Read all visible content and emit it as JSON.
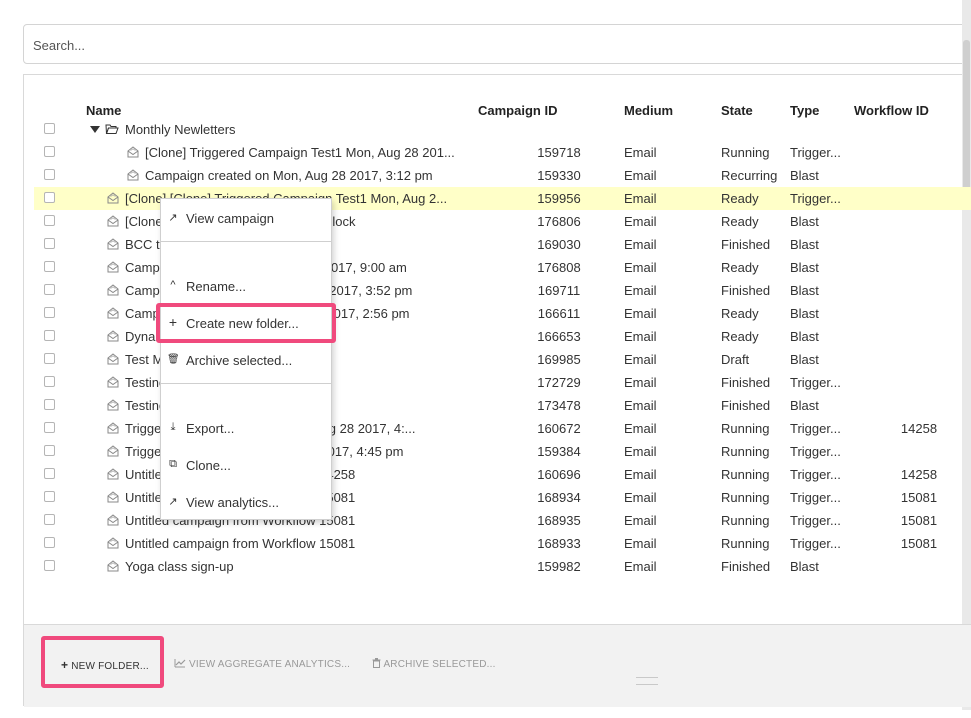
{
  "search": {
    "placeholder": "Search..."
  },
  "columns": {
    "name": "Name",
    "campaign_id": "Campaign ID",
    "medium": "Medium",
    "state": "State",
    "type": "Type",
    "workflow_id": "Workflow ID"
  },
  "rows": [
    {
      "name": "Monthly Newletters",
      "campaign_id": "",
      "medium": "",
      "state": "",
      "type": "",
      "workflow_id": "",
      "icon": "folder-open-icon"
    },
    {
      "name": "[Clone] Triggered Campaign Test1 Mon, Aug 28 201...",
      "campaign_id": "159718",
      "medium": "Email",
      "state": "Running",
      "type": "Trigger...",
      "workflow_id": "",
      "icon": "envelope-icon"
    },
    {
      "name": "Campaign created on Mon, Aug 28 2017, 3:12 pm",
      "campaign_id": "159330",
      "medium": "Email",
      "state": "Recurring",
      "type": "Blast",
      "workflow_id": "",
      "icon": "envelope-icon"
    },
    {
      "name": "[Clone] [Clone] Triggered Campaign Test1 Mon, Aug 2...",
      "campaign_id": "159956",
      "medium": "Email",
      "state": "Ready",
      "type": "Trigger...",
      "workflow_id": "",
      "icon": "envelope-icon"
    },
    {
      "name": "[Clone] Campaign with conditional block",
      "campaign_id": "176806",
      "medium": "Email",
      "state": "Ready",
      "type": "Blast",
      "workflow_id": "",
      "icon": "envelope-icon"
    },
    {
      "name": "BCC test",
      "campaign_id": "169030",
      "medium": "Email",
      "state": "Finished",
      "type": "Blast",
      "workflow_id": "",
      "icon": "envelope-icon"
    },
    {
      "name": "Campaign created on Tue, Oct 22 2017, 9:00 am",
      "campaign_id": "176808",
      "medium": "Email",
      "state": "Ready",
      "type": "Blast",
      "workflow_id": "",
      "icon": "envelope-icon"
    },
    {
      "name": "Campaign created on Mon, Sep 11 2017, 3:52 pm",
      "campaign_id": "169711",
      "medium": "Email",
      "state": "Finished",
      "type": "Blast",
      "workflow_id": "",
      "icon": "envelope-icon"
    },
    {
      "name": "Campaign created on Thu, Aug 31 2017, 2:56 pm",
      "campaign_id": "166611",
      "medium": "Email",
      "state": "Ready",
      "type": "Blast",
      "workflow_id": "",
      "icon": "envelope-icon"
    },
    {
      "name": "Dynamic content",
      "campaign_id": "166653",
      "medium": "Email",
      "state": "Ready",
      "type": "Blast",
      "workflow_id": "",
      "icon": "envelope-icon"
    },
    {
      "name": "Test Merge tags",
      "campaign_id": "169985",
      "medium": "Email",
      "state": "Draft",
      "type": "Blast",
      "workflow_id": "",
      "icon": "envelope-icon"
    },
    {
      "name": "Testing triggered",
      "campaign_id": "172729",
      "medium": "Email",
      "state": "Finished",
      "type": "Trigger...",
      "workflow_id": "",
      "icon": "envelope-icon"
    },
    {
      "name": "Testing blast",
      "campaign_id": "173478",
      "medium": "Email",
      "state": "Finished",
      "type": "Blast",
      "workflow_id": "",
      "icon": "envelope-icon"
    },
    {
      "name": "Triggered Campaign Test1 Mon, Aug 28 2017, 4:...",
      "campaign_id": "160672",
      "medium": "Email",
      "state": "Running",
      "type": "Trigger...",
      "workflow_id": "14258",
      "icon": "envelope-icon"
    },
    {
      "name": "Triggered campaign Mon, Aug 28 2017, 4:45 pm",
      "campaign_id": "159384",
      "medium": "Email",
      "state": "Running",
      "type": "Trigger...",
      "workflow_id": "",
      "icon": "envelope-icon"
    },
    {
      "name": "Untitled campaign from Workflow 14258",
      "campaign_id": "160696",
      "medium": "Email",
      "state": "Running",
      "type": "Trigger...",
      "workflow_id": "14258",
      "icon": "envelope-icon"
    },
    {
      "name": "Untitled campaign from Workflow 15081",
      "campaign_id": "168934",
      "medium": "Email",
      "state": "Running",
      "type": "Trigger...",
      "workflow_id": "15081",
      "icon": "envelope-icon"
    },
    {
      "name": "Untitled campaign from Workflow 15081",
      "campaign_id": "168935",
      "medium": "Email",
      "state": "Running",
      "type": "Trigger...",
      "workflow_id": "15081",
      "icon": "envelope-icon"
    },
    {
      "name": "Untitled campaign from Workflow 15081",
      "campaign_id": "168933",
      "medium": "Email",
      "state": "Running",
      "type": "Trigger...",
      "workflow_id": "15081",
      "icon": "envelope-icon"
    },
    {
      "name": "Yoga class sign-up",
      "campaign_id": "159982",
      "medium": "Email",
      "state": "Finished",
      "type": "Blast",
      "workflow_id": "",
      "icon": "envelope-icon"
    }
  ],
  "context_menu": {
    "items": [
      {
        "label": "View campaign",
        "glyph": "↗",
        "icon": "external-link-icon"
      },
      {
        "label": "Rename...",
        "glyph": "^",
        "icon": "caret-up-icon"
      },
      {
        "label": "Create new folder...",
        "glyph": "+",
        "icon": "plus-icon"
      },
      {
        "label": "Archive selected...",
        "glyph": "🗑",
        "icon": "trash-icon"
      },
      {
        "label": "Export...",
        "glyph": "⤓",
        "icon": "download-icon"
      },
      {
        "label": "Clone...",
        "glyph": "⧉",
        "icon": "clone-icon"
      },
      {
        "label": "View analytics...",
        "glyph": "↗",
        "icon": "external-link-icon"
      }
    ]
  },
  "footer": {
    "new_folder": "NEW FOLDER...",
    "new_folder_glyph": "+",
    "view_aggregate": "VIEW AGGREGATE ANALYTICS...",
    "archive_selected": "ARCHIVE SELECTED..."
  },
  "colors": {
    "highlight_row": "#ffffc8",
    "annotation": "#f04a7d"
  }
}
